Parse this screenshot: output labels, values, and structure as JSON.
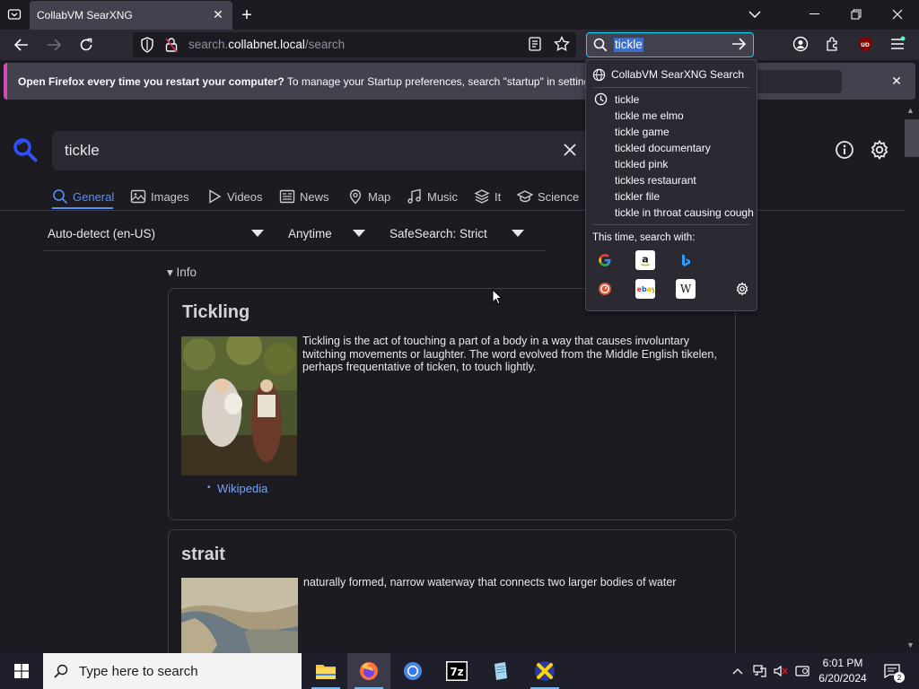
{
  "browser": {
    "tab_title": "CollabVM SearXNG",
    "url_scheme": "search.",
    "url_host": "collabnet.local",
    "url_path": "/search",
    "search_box_value": "tickle"
  },
  "notification": {
    "bold": "Open Firefox every time you restart your computer?",
    "text": " To manage your Startup preferences, search \"startup\" in settings."
  },
  "page": {
    "query": "tickle",
    "categories": [
      "General",
      "Images",
      "Videos",
      "News",
      "Map",
      "Music",
      "It",
      "Science"
    ],
    "filters": {
      "language": "Auto-detect (en-US)",
      "time": "Anytime",
      "safesearch": "SafeSearch: Strict"
    },
    "info_toggle": "▾ Info",
    "cards": [
      {
        "title": "Tickling",
        "body": "Tickling is the act of touching a part of a body in a way that causes involuntary twitching movements or laughter. The word evolved from the Middle English tikelen, perhaps frequentative of ticken, to touch lightly.",
        "link": "Wikipedia"
      },
      {
        "title": "strait",
        "body": "naturally formed, narrow waterway that connects two larger bodies of water"
      }
    ]
  },
  "popup": {
    "engine_label": "CollabVM SearXNG Search",
    "suggestions": [
      "tickle",
      "tickle me elmo",
      "tickle game",
      "tickled documentary",
      "tickled pink",
      "tickles restaurant",
      "tickler file",
      "tickle in throat causing cough"
    ],
    "search_with_label": "This time, search with:",
    "engines": [
      "google",
      "amazon",
      "bing",
      "duckduckgo",
      "ebay",
      "wikipedia"
    ]
  },
  "taskbar": {
    "search_placeholder": "Type here to search",
    "time": "6:01 PM",
    "date": "6/20/2024"
  },
  "colors": {
    "accent": "#00ddff",
    "link": "#7aa5f5",
    "category_active": "#5a8ff0",
    "notification_stripe": "#d74cb0"
  }
}
